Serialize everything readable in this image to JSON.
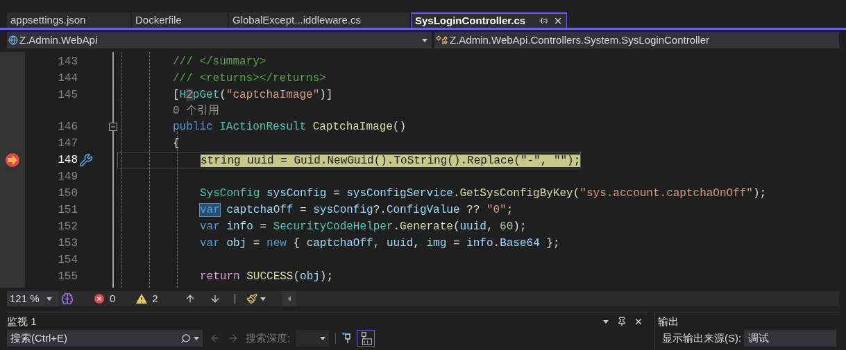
{
  "tabs": [
    {
      "label": "appsettings.json",
      "selected": false
    },
    {
      "label": "Dockerfile",
      "selected": false
    },
    {
      "label": "GlobalExcept...iddleware.cs",
      "selected": false
    },
    {
      "label": "SysLoginController.cs",
      "selected": true
    }
  ],
  "nav": {
    "project": "Z.Admin.WebApi",
    "member": "Z.Admin.WebApi.Controllers.System.SysLoginController"
  },
  "lines": [
    {
      "kind": "code",
      "number": "143",
      "current": false,
      "tokens": [
        {
          "text": "/// </summary>",
          "kind": "comment"
        }
      ]
    },
    {
      "kind": "code",
      "number": "144",
      "current": false,
      "tokens": [
        {
          "text": "/// <returns></returns>",
          "kind": "comment"
        }
      ]
    },
    {
      "kind": "code",
      "number": "145",
      "current": false,
      "tokens": [
        {
          "text": "[",
          "kind": "plain"
        },
        {
          "text": "H",
          "kind": "type"
        },
        {
          "text": "2",
          "kind": "badge"
        },
        {
          "text": "pGet",
          "kind": "type"
        },
        {
          "text": "(",
          "kind": "plain"
        },
        {
          "text": "\"captchaImage\"",
          "kind": "string"
        },
        {
          "text": ")]",
          "kind": "plain"
        }
      ]
    },
    {
      "kind": "codelens",
      "text": "0 个引用"
    },
    {
      "kind": "code",
      "number": "146",
      "current": false,
      "expanded": true,
      "tokens": [
        {
          "text": "public ",
          "kind": "keyword"
        },
        {
          "text": "IActionResult ",
          "kind": "type"
        },
        {
          "text": "CaptchaImage",
          "kind": "method"
        },
        {
          "text": "()",
          "kind": "plain"
        }
      ]
    },
    {
      "kind": "code",
      "number": "147",
      "current": false,
      "tokens": [
        {
          "text": "{",
          "kind": "plain"
        }
      ],
      "children": [
        {
          "kind": "code",
          "number": "148",
          "current": true,
          "tokens": [
            {
              "text": "string uuid = Guid.NewGuid().ToString().Replace(\"-\", \"\");",
              "kind": "plain"
            }
          ]
        },
        {
          "kind": "code",
          "number": "149",
          "current": false
        },
        {
          "kind": "code",
          "number": "150",
          "current": false,
          "tokens": [
            {
              "text": "SysConfig ",
              "kind": "type"
            },
            {
              "text": "sysConfig",
              "kind": "variable"
            },
            {
              "text": " = ",
              "kind": "plain"
            },
            {
              "text": "sysConfigService",
              "kind": "variable"
            },
            {
              "text": ".",
              "kind": "plain"
            },
            {
              "text": "GetSysConfigByKey",
              "kind": "method"
            },
            {
              "text": "(",
              "kind": "plain"
            },
            {
              "text": "\"sys.account.captchaOnOff\"",
              "kind": "string"
            },
            {
              "text": ");",
              "kind": "plain"
            }
          ]
        },
        {
          "kind": "code",
          "number": "151",
          "current": false,
          "tokens": [
            {
              "text": "var",
              "kind": "keyword",
              "selected": true
            },
            {
              "text": " captchaOff",
              "kind": "variable"
            },
            {
              "text": " = ",
              "kind": "plain"
            },
            {
              "text": "sysConfig",
              "kind": "variable"
            },
            {
              "text": "?.",
              "kind": "plain"
            },
            {
              "text": "ConfigValue",
              "kind": "variable"
            },
            {
              "text": " ?? ",
              "kind": "plain"
            },
            {
              "text": "\"0\"",
              "kind": "string"
            },
            {
              "text": ";",
              "kind": "plain"
            }
          ]
        },
        {
          "kind": "code",
          "number": "152",
          "current": false,
          "tokens": [
            {
              "text": "var",
              "kind": "keyword",
              "selected": false
            },
            {
              "text": " info",
              "kind": "variable"
            },
            {
              "text": " = ",
              "kind": "plain"
            },
            {
              "text": "SecurityCodeHelper",
              "kind": "type"
            },
            {
              "text": ".",
              "kind": "plain"
            },
            {
              "text": "Generate",
              "kind": "method"
            },
            {
              "text": "(",
              "kind": "plain"
            },
            {
              "text": "uuid",
              "kind": "variable"
            },
            {
              "text": ", ",
              "kind": "plain"
            },
            {
              "text": "60",
              "kind": "number"
            },
            {
              "text": ");",
              "kind": "plain"
            }
          ]
        },
        {
          "kind": "code",
          "number": "153",
          "current": false,
          "tokens": [
            {
              "text": "var",
              "kind": "keyword",
              "selected": false
            },
            {
              "text": " obj",
              "kind": "variable"
            },
            {
              "text": " = ",
              "kind": "plain"
            },
            {
              "text": "new",
              "kind": "keyword",
              "selected": false
            },
            {
              "text": " { ",
              "kind": "plain"
            },
            {
              "text": "captchaOff",
              "kind": "variable"
            },
            {
              "text": ", ",
              "kind": "plain"
            },
            {
              "text": "uuid",
              "kind": "variable"
            },
            {
              "text": ", ",
              "kind": "plain"
            },
            {
              "text": "img",
              "kind": "variable"
            },
            {
              "text": " = ",
              "kind": "plain"
            },
            {
              "text": "info",
              "kind": "variable"
            },
            {
              "text": ".",
              "kind": "plain"
            },
            {
              "text": "Base64",
              "kind": "variable"
            },
            {
              "text": " };",
              "kind": "plain"
            }
          ]
        },
        {
          "kind": "code",
          "number": "154",
          "current": false
        },
        {
          "kind": "code",
          "number": "155",
          "current": false,
          "tokens": [
            {
              "text": "return ",
              "kind": "control"
            },
            {
              "text": "SUCCESS",
              "kind": "method"
            },
            {
              "text": "(",
              "kind": "plain"
            },
            {
              "text": "obj",
              "kind": "variable"
            },
            {
              "text": ");",
              "kind": "plain"
            }
          ]
        }
      ]
    }
  ],
  "status_bar": {
    "zoom": "121 %",
    "errors": "0",
    "warnings": "2"
  },
  "watch": {
    "title": "监视 1",
    "search": {
      "placeholder": "搜索(Ctrl+E)"
    },
    "depth_label": "搜索深度:"
  },
  "output": {
    "title": "输出",
    "source_label": "显示输出来源(S):",
    "source": "调试"
  }
}
